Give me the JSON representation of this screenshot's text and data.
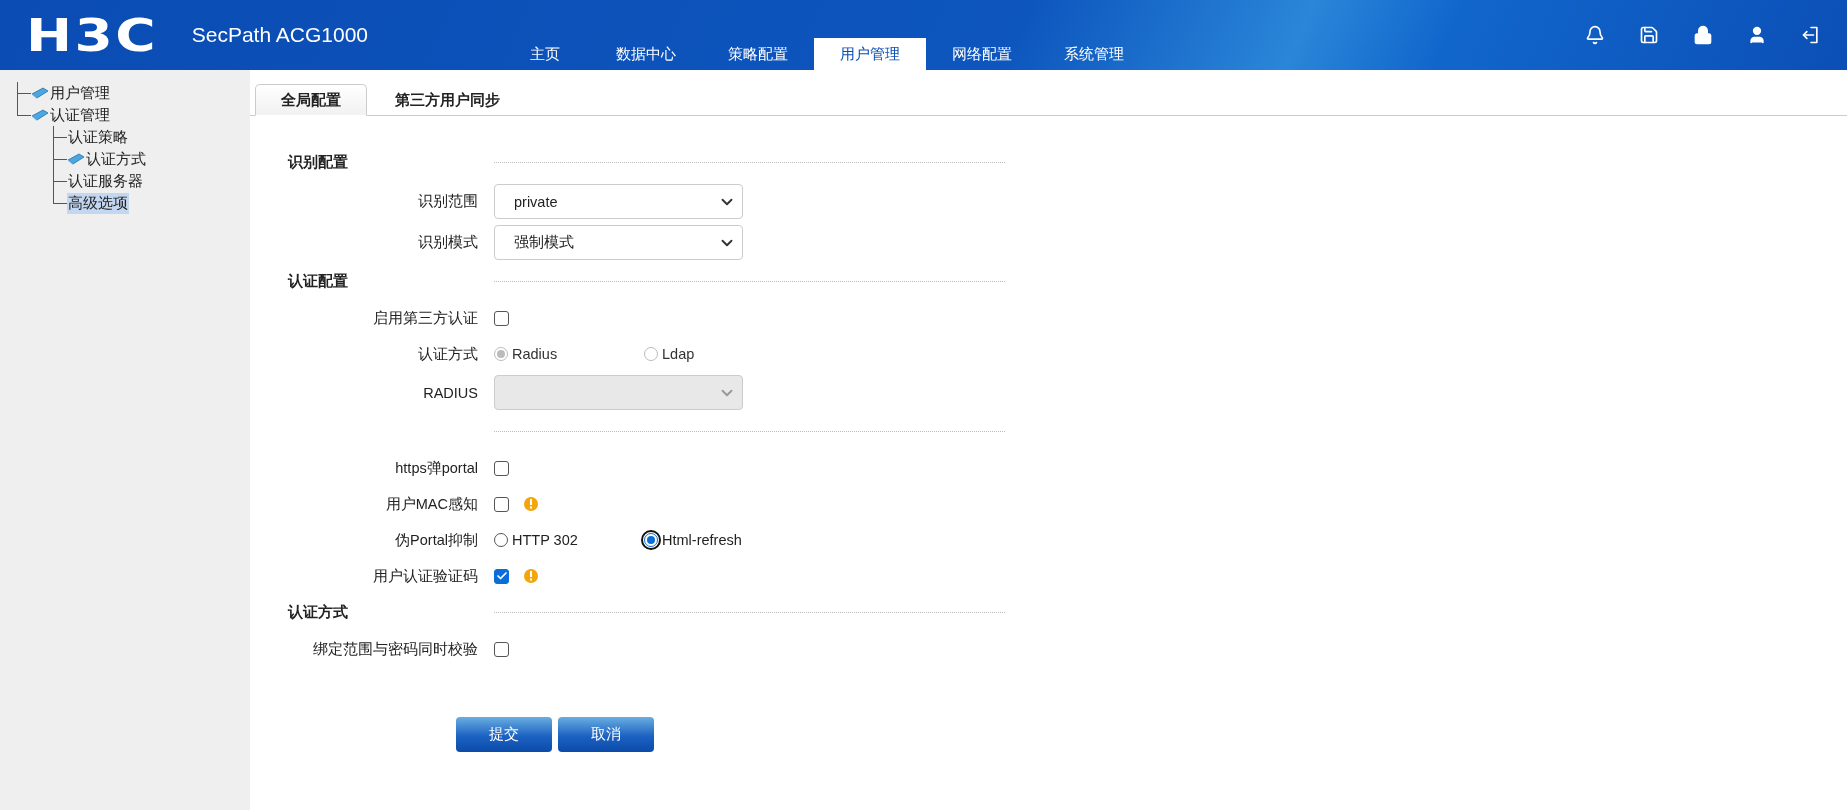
{
  "header": {
    "logo": "H3C",
    "product": "SecPath ACG1000",
    "nav": [
      {
        "label": "主页",
        "selected": false
      },
      {
        "label": "数据中心",
        "selected": false
      },
      {
        "label": "策略配置",
        "selected": false
      },
      {
        "label": "用户管理",
        "selected": true
      },
      {
        "label": "网络配置",
        "selected": false
      },
      {
        "label": "系统管理",
        "selected": false
      }
    ],
    "tools": [
      {
        "kind": "bell"
      },
      {
        "kind": "save"
      },
      {
        "kind": "lock"
      },
      {
        "kind": "user"
      },
      {
        "kind": "exit"
      }
    ]
  },
  "sidebar": {
    "tree": [
      {
        "label": "用户管理",
        "folder": true,
        "selected": false
      },
      {
        "label": "认证管理",
        "folder": true,
        "selected": false,
        "children": [
          {
            "label": "认证策略",
            "folder": false,
            "selected": false
          },
          {
            "label": "认证方式",
            "folder": true,
            "selected": false
          },
          {
            "label": "认证服务器",
            "folder": false,
            "selected": false
          },
          {
            "label": "高级选项",
            "folder": false,
            "selected": true
          }
        ]
      }
    ]
  },
  "tabs": [
    {
      "label": "全局配置",
      "selected": true
    },
    {
      "label": "第三方用户同步",
      "selected": false
    }
  ],
  "sections": [
    {
      "title": "识别配置",
      "rows": [
        {
          "kind": "select",
          "label": "识别范围",
          "value": "private",
          "disabled": false
        },
        {
          "kind": "select",
          "label": "识别模式",
          "value": "强制模式",
          "disabled": false
        }
      ]
    },
    {
      "title": "认证配置",
      "rows": [
        {
          "kind": "checkbox",
          "label": "启用第三方认证",
          "checked": false,
          "warning": false
        },
        {
          "kind": "radio",
          "label": "认证方式",
          "options": [
            {
              "label": "Radius",
              "selected": true,
              "disabled": true,
              "focused": false
            },
            {
              "label": "Ldap",
              "selected": false,
              "disabled": true,
              "focused": false
            }
          ]
        },
        {
          "kind": "select",
          "label": "RADIUS",
          "disabled": true
        }
      ]
    },
    {
      "rows": [
        {
          "kind": "checkbox",
          "label": "https弹portal",
          "checked": false,
          "warning": false
        },
        {
          "kind": "checkbox",
          "label": "用户MAC感知",
          "checked": false,
          "warning": true
        },
        {
          "kind": "radio",
          "label": "伪Portal抑制",
          "options": [
            {
              "label": "HTTP 302",
              "selected": false,
              "disabled": false,
              "focused": false
            },
            {
              "label": "Html-refresh",
              "selected": true,
              "disabled": false,
              "focused": true
            }
          ]
        },
        {
          "kind": "checkbox",
          "label": "用户认证验证码",
          "checked": true,
          "warning": true
        }
      ]
    },
    {
      "title": "认证方式",
      "rows": [
        {
          "kind": "checkbox",
          "label": "绑定范围与密码同时校验",
          "checked": false,
          "warning": false
        }
      ]
    }
  ],
  "buttons": [
    {
      "label": "提交"
    },
    {
      "label": "取消"
    }
  ]
}
